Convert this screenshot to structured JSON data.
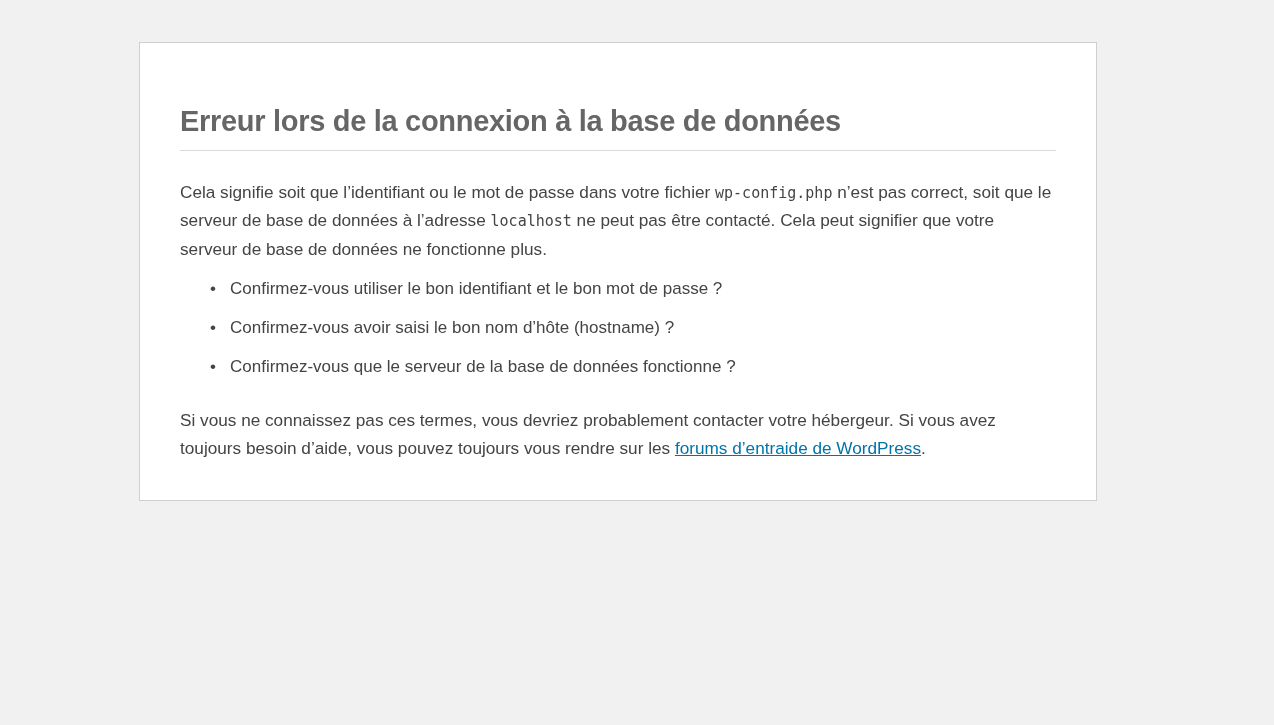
{
  "title": "Erreur lors de la connexion à la base de données",
  "intro": [
    {
      "kind": "text",
      "text": "Cela signifie soit que l’identifiant ou le mot de passe dans votre fichier "
    },
    {
      "kind": "code",
      "text": "wp-config.php"
    },
    {
      "kind": "text",
      "text": " n’est pas correct, soit que le serveur de base de données à l’adresse "
    },
    {
      "kind": "code",
      "text": "localhost"
    },
    {
      "kind": "text",
      "text": " ne peut pas être contacté. Cela peut signifier que votre serveur de base de données ne fonctionne plus."
    }
  ],
  "questions": [
    {
      "marker": "•",
      "text": "Confirmez-vous utiliser le bon identifiant et le bon mot de passe ?"
    },
    {
      "marker": "•",
      "text": "Confirmez-vous avoir saisi le bon nom d’hôte (hostname) ?"
    },
    {
      "marker": "•",
      "text": "Confirmez-vous que le serveur de la base de données fonctionne ?"
    }
  ],
  "help": [
    {
      "kind": "text",
      "text": "Si vous ne connaissez pas ces termes, vous devriez probablement contacter votre hébergeur. Si vous avez toujours besoin d’aide, vous pouvez toujours vous rendre sur les "
    },
    {
      "kind": "link",
      "text": "forums d’entraide de WordPress"
    },
    {
      "kind": "text",
      "text": "."
    }
  ]
}
